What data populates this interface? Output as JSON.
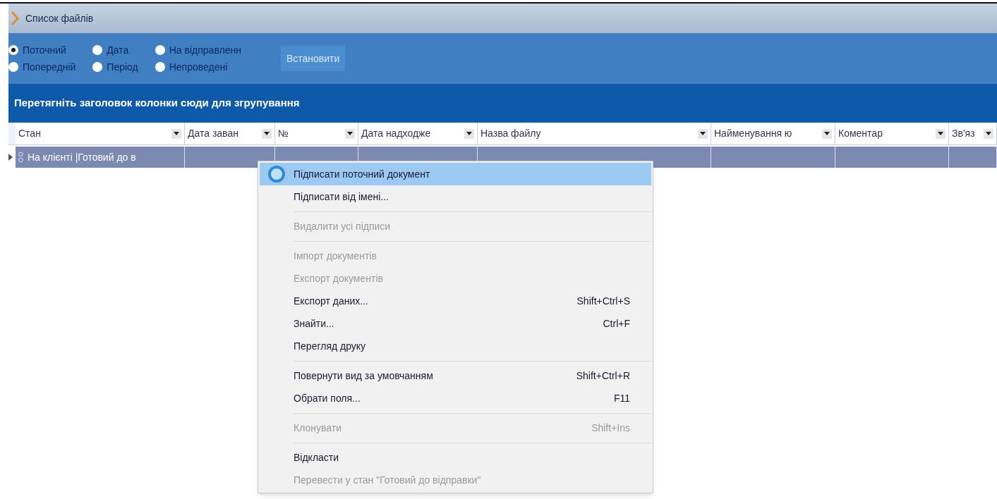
{
  "window": {
    "title": "Список файлів"
  },
  "filters": [
    {
      "label": "Поточний",
      "selected": true
    },
    {
      "label": "Попередній",
      "selected": false
    },
    {
      "label": "Дата",
      "selected": false
    },
    {
      "label": "Період",
      "selected": false
    },
    {
      "label": "На відправленн",
      "selected": false
    },
    {
      "label": "Непроведені",
      "selected": false
    }
  ],
  "apply_button": "Встановити",
  "group_hint": "Перетягніть заголовок колонки сюди для згрупування",
  "table": {
    "columns": [
      "Стан",
      "Дата заван",
      "№",
      "Дата надходже",
      "Назва файлу",
      "Найменування ю",
      "Коментар",
      "Зв'яз"
    ],
    "rows": [
      {
        "selected": true,
        "cells": [
          "На клієнті |Готовий до в"
        ]
      }
    ]
  },
  "context_menu": [
    {
      "kind": "item",
      "label": "Підписати поточний документ",
      "selected": true,
      "disabled": false
    },
    {
      "kind": "item",
      "label": "Підписати від імені...",
      "selected": false,
      "disabled": false
    },
    {
      "kind": "separator"
    },
    {
      "kind": "item",
      "label": "Видалити усі підписи",
      "selected": false,
      "disabled": true
    },
    {
      "kind": "separator"
    },
    {
      "kind": "item",
      "label": "Імпорт документів",
      "selected": false,
      "disabled": true
    },
    {
      "kind": "item",
      "label": "Експорт документів",
      "selected": false,
      "disabled": true
    },
    {
      "kind": "item",
      "label": "Експорт даних...",
      "shortcut": "Shift+Ctrl+S",
      "selected": false,
      "disabled": false
    },
    {
      "kind": "item",
      "label": "Знайти...",
      "shortcut": "Ctrl+F",
      "selected": false,
      "disabled": false
    },
    {
      "kind": "item",
      "label": "Перегляд друку",
      "selected": false,
      "disabled": false
    },
    {
      "kind": "separator"
    },
    {
      "kind": "item",
      "label": "Повернути вид за умовчанням",
      "shortcut": "Shift+Ctrl+R",
      "selected": false,
      "disabled": false
    },
    {
      "kind": "item",
      "label": "Обрати поля...",
      "shortcut": "F11",
      "selected": false,
      "disabled": false
    },
    {
      "kind": "separator"
    },
    {
      "kind": "item",
      "label": "Клонувати",
      "shortcut": "Shift+Ins",
      "selected": false,
      "disabled": true
    },
    {
      "kind": "separator"
    },
    {
      "kind": "item",
      "label": "Відкласти",
      "selected": false,
      "disabled": false
    },
    {
      "kind": "item",
      "label": "Перевести у стан \"Готовий до відправки\"",
      "selected": false,
      "disabled": true
    }
  ]
}
